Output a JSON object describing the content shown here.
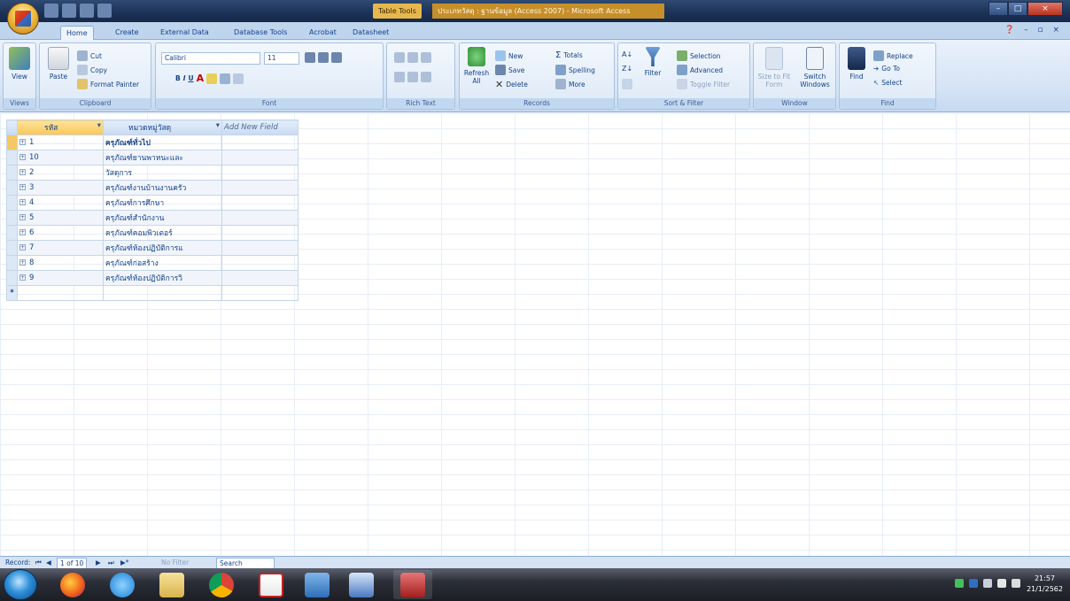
{
  "title_bar": {
    "context_tab": "Table Tools",
    "window_title": "ประเภทวัสดุ : ฐานข้อมูล (Access 2007) - Microsoft Access",
    "controls": [
      "–",
      "□",
      "×"
    ]
  },
  "ribbon_tabs": [
    "Home",
    "Create",
    "External Data",
    "Database Tools",
    "Acrobat",
    "Datasheet"
  ],
  "help": "❓ – ▫ ×",
  "ribbon": {
    "views": {
      "view": "View",
      "label": "Views"
    },
    "clipboard": {
      "paste": "Paste",
      "cut": "Cut",
      "copy": "Copy",
      "format_painter": "Format Painter",
      "label": "Clipboard"
    },
    "font": {
      "font_name": "Calibri",
      "font_size": "11",
      "label": "Font"
    },
    "rich_text": {
      "label": "Rich Text"
    },
    "records": {
      "refresh": "Refresh All",
      "new": "New",
      "save": "Save",
      "delete": "Delete",
      "totals": "Totals",
      "spelling": "Spelling",
      "more": "More",
      "label": "Records"
    },
    "sort_filter": {
      "filter": "Filter",
      "selection": "Selection",
      "advanced": "Advanced",
      "toggle_filter": "Toggle Filter",
      "label": "Sort & Filter"
    },
    "window": {
      "size_to_fit": "Size to Fit Form",
      "switch_windows": "Switch Windows",
      "label": "Window"
    },
    "find": {
      "find": "Find",
      "replace": "Replace",
      "goto": "Go To",
      "select": "Select",
      "label": "Find"
    }
  },
  "datasheet": {
    "columns": [
      "รหัส",
      "หมวดหมู่วัสดุ",
      "Add New Field"
    ],
    "rows": [
      {
        "id": "1",
        "name": "ครุภัณฑ์ทั่วไป"
      },
      {
        "id": "10",
        "name": "ครุภัณฑ์ยานพาหนะและ"
      },
      {
        "id": "2",
        "name": "วัสดุการ"
      },
      {
        "id": "3",
        "name": "ครุภัณฑ์งานบ้านงานครัว"
      },
      {
        "id": "4",
        "name": "ครุภัณฑ์การศึกษา"
      },
      {
        "id": "5",
        "name": "ครุภัณฑ์สำนักงาน"
      },
      {
        "id": "6",
        "name": "ครุภัณฑ์คอมพิวเตอร์"
      },
      {
        "id": "7",
        "name": "ครุภัณฑ์ห้องปฏิบัติการแ"
      },
      {
        "id": "8",
        "name": "ครุภัณฑ์ก่อสร้าง"
      },
      {
        "id": "9",
        "name": "ครุภัณฑ์ห้องปฏิบัติการวิ"
      }
    ],
    "new_row_marker": "*"
  },
  "navigator": {
    "record_label": "Record:",
    "first": "⏮",
    "prev": "◀",
    "position": "1 of 10",
    "next": "▶",
    "last": "⏭",
    "new": "▶*",
    "filter": "No Filter",
    "search": "Search"
  },
  "taskbar": {
    "clock_time": "21:57",
    "clock_date": "21/1/2562"
  }
}
